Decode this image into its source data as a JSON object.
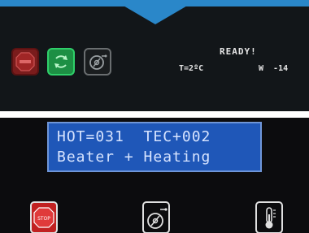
{
  "top_panel": {
    "status": "READY!",
    "temperature": "T=2ºC",
    "w_value": "W  -14",
    "buttons": [
      {
        "name": "stop",
        "color": "#7a1c1c"
      },
      {
        "name": "start",
        "color": "#1d8f44"
      },
      {
        "name": "motor",
        "color": "#1a1d1f"
      }
    ],
    "accent_color": "#2a87c9"
  },
  "lcd": {
    "line1": "HOT=031  TEC+002",
    "line2": "Beater + Heating",
    "background": "#1f57b8"
  },
  "bottom_icons": [
    {
      "name": "stop-icon",
      "label": "STOP"
    },
    {
      "name": "motor-icon"
    },
    {
      "name": "thermometer-icon"
    }
  ]
}
